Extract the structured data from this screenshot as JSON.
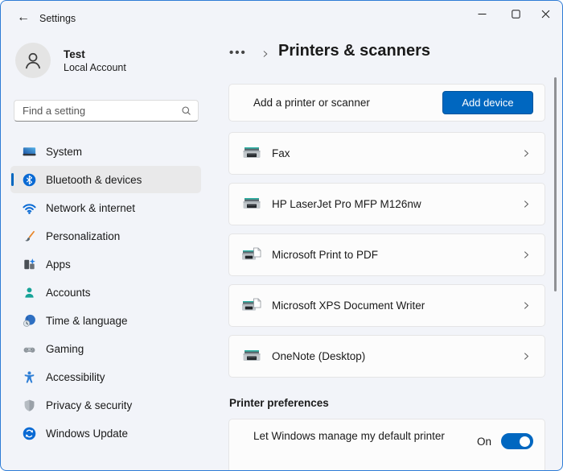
{
  "window": {
    "title": "Settings"
  },
  "user": {
    "name": "Test",
    "subtitle": "Local Account"
  },
  "search": {
    "placeholder": "Find a setting"
  },
  "sidebar": {
    "items": [
      {
        "label": "System",
        "icon": "system-icon",
        "active": false
      },
      {
        "label": "Bluetooth & devices",
        "icon": "bluetooth-icon",
        "active": true
      },
      {
        "label": "Network & internet",
        "icon": "network-icon",
        "active": false
      },
      {
        "label": "Personalization",
        "icon": "personalization-icon",
        "active": false
      },
      {
        "label": "Apps",
        "icon": "apps-icon",
        "active": false
      },
      {
        "label": "Accounts",
        "icon": "accounts-icon",
        "active": false
      },
      {
        "label": "Time & language",
        "icon": "time-language-icon",
        "active": false
      },
      {
        "label": "Gaming",
        "icon": "gaming-icon",
        "active": false
      },
      {
        "label": "Accessibility",
        "icon": "accessibility-icon",
        "active": false
      },
      {
        "label": "Privacy & security",
        "icon": "privacy-icon",
        "active": false
      },
      {
        "label": "Windows Update",
        "icon": "windows-update-icon",
        "active": false
      }
    ]
  },
  "page": {
    "breadcrumb_ellipsis": "•••",
    "title": "Printers & scanners"
  },
  "add_device": {
    "label": "Add a printer or scanner",
    "button": "Add device"
  },
  "printers": [
    {
      "name": "Fax",
      "icon": "printer-icon"
    },
    {
      "name": "HP LaserJet Pro MFP M126nw",
      "icon": "printer-icon"
    },
    {
      "name": "Microsoft Print to PDF",
      "icon": "printer-document-icon"
    },
    {
      "name": "Microsoft XPS Document Writer",
      "icon": "printer-document-icon"
    },
    {
      "name": "OneNote (Desktop)",
      "icon": "printer-icon"
    }
  ],
  "preferences": {
    "heading": "Printer preferences",
    "toggle_label": "Let Windows manage my default printer",
    "toggle_state": "On",
    "toggle_on": true
  },
  "colors": {
    "accent": "#0067c0",
    "window_border": "#2e7cd6",
    "scrollbar": "#8f9094"
  }
}
